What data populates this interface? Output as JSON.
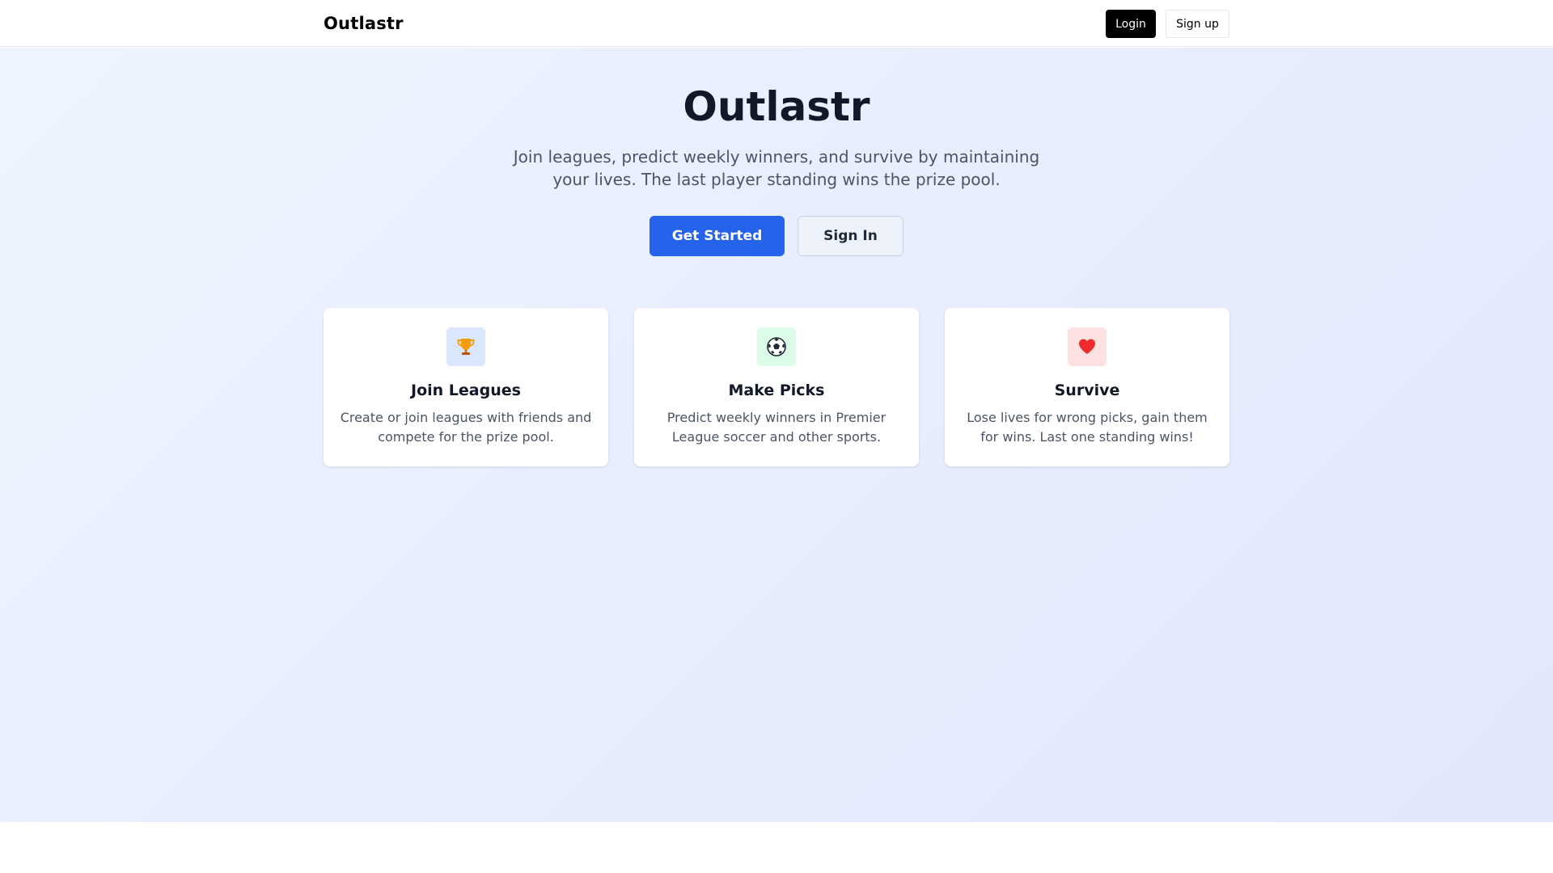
{
  "nav": {
    "brand": "Outlastr",
    "login_label": "Login",
    "signup_label": "Sign up"
  },
  "hero": {
    "title": "Outlastr",
    "subtitle": "Join leagues, predict weekly winners, and survive by maintaining your lives. The last player standing wins the prize pool.",
    "primary_button": "Get Started",
    "secondary_button": "Sign In"
  },
  "features": [
    {
      "icon": "trophy-icon",
      "icon_bg": "#dbe7fe",
      "title": "Join Leagues",
      "description": "Create or join leagues with friends and compete for the prize pool."
    },
    {
      "icon": "soccer-ball-icon",
      "icon_bg": "#dcfce7",
      "title": "Make Picks",
      "description": "Predict weekly winners in Premier League soccer and other sports."
    },
    {
      "icon": "heart-icon",
      "icon_bg": "#fee2e2",
      "title": "Survive",
      "description": "Lose lives for wrong picks, gain them for wins. Last one standing wins!"
    }
  ],
  "colors": {
    "primary": "#2563eb",
    "nav_login_bg": "#000000",
    "heading": "#111827",
    "body_text": "#4b5563"
  }
}
